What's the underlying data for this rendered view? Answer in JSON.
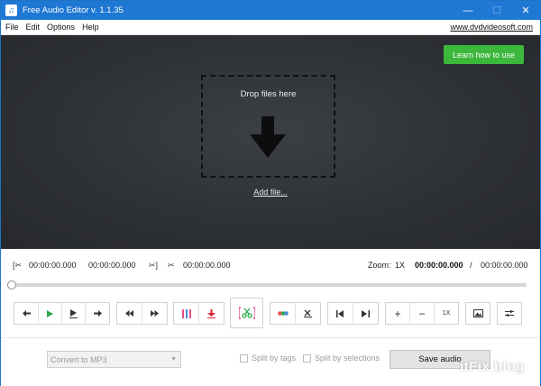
{
  "window": {
    "title": "Free Audio Editor v. 1.1.35",
    "controls": {
      "minimize": "—",
      "maximize": "☐",
      "close": "✕"
    }
  },
  "menu": {
    "items": [
      "File",
      "Edit",
      "Options",
      "Help"
    ],
    "site_link": "www.dvdvideosoft.com"
  },
  "drop_area": {
    "learn_button": "Learn how to use",
    "drop_text": "Drop files here",
    "add_file_link": "Add file...",
    "arrow_icon": "download-arrow-icon"
  },
  "timeline": {
    "sel_start": "00:00:00.000",
    "sel_end": "00:00:00.000",
    "cut_time": "00:00:00.000",
    "zoom_label": "Zoom:",
    "zoom_value": "1X",
    "current_time": "00:00:00.000",
    "separator": "/",
    "total_time": "00:00:00.000",
    "seek_progress": 0
  },
  "controls": {
    "playback": [
      "←",
      "▶",
      "▶̲",
      "→"
    ],
    "skip": [
      "⏮",
      "⏭"
    ],
    "zoom_in": "+",
    "zoom_out": "−",
    "zoom_reset": "1X"
  },
  "bottom": {
    "format_select": "Convert to MP3",
    "split_by_tags": "Split by tags",
    "split_by_selections": "Split by selections",
    "save_button": "Save audio",
    "watermark": "itFix blog"
  },
  "colors": {
    "titlebar": "#1e78d4",
    "accent_green": "#3cb83c",
    "drop_bg": "#2e3135"
  }
}
